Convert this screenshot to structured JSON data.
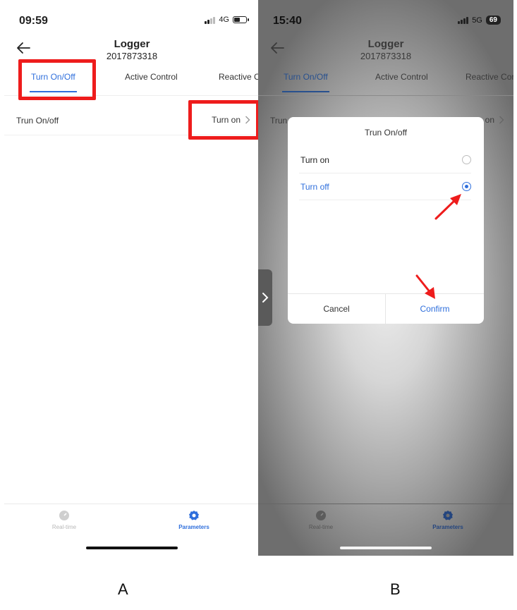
{
  "panel_a": {
    "time": "09:59",
    "network": "4G",
    "title": "Logger",
    "serial": "2017873318",
    "tabs": [
      "Turn On/Off",
      "Active Control",
      "Reactive C"
    ],
    "row_label": "Trun On/off",
    "row_value": "Turn on",
    "bottom_nav": [
      "Real-time",
      "Parameters"
    ],
    "caption": "A"
  },
  "panel_b": {
    "time": "15:40",
    "network": "5G",
    "battery": "69",
    "title": "Logger",
    "serial": "2017873318",
    "tabs": [
      "Turn On/Off",
      "Active Control",
      "Reactive Cor"
    ],
    "row_label_partial": "Trun O",
    "row_value_partial": "on",
    "bottom_nav": [
      "Real-time",
      "Parameters"
    ],
    "dialog": {
      "title": "Trun On/off",
      "options": [
        {
          "label": "Turn on",
          "selected": false
        },
        {
          "label": "Turn off",
          "selected": true
        }
      ],
      "cancel": "Cancel",
      "confirm": "Confirm"
    },
    "caption": "B"
  },
  "colors": {
    "accent": "#2f6fdc",
    "highlight": "#ee1c1c"
  }
}
